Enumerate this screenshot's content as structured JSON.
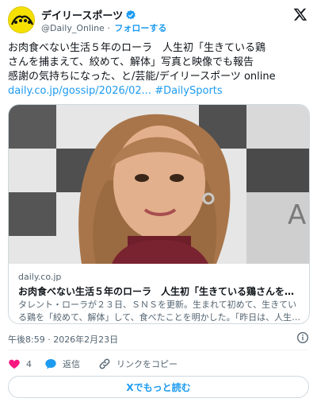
{
  "account": {
    "name": "デイリースポーツ",
    "handle": "@Daily_Online",
    "separator": " · ",
    "follow_label": "フォローする"
  },
  "tweet": {
    "text_lines": [
      "お肉食べない生活５年のローラ　人生初「生きている鶏",
      "さんを捕まえて、絞めて、解体」写真と映像でも報告",
      "感謝の気持ちになった、と/芸能/デイリースポーツ online"
    ],
    "link": "daily.co.jp/gossip/2026/02...",
    "hashtag": "#DailySports"
  },
  "card": {
    "domain": "daily.co.jp",
    "title": "お肉食べない生活５年のローラ　人生初「生きている鶏さんを捕まえて…",
    "description": "タレント・ローラが２３日、ＳＮＳを更新。生まれて初めて、生きている鶏を「絞めて、解体」して、食べたことを明かした。「昨日は、人生…"
  },
  "timestamp": "午後8:59 · 2026年2月23日",
  "actions": {
    "like_count": "4",
    "reply_label": "返信",
    "copy_link_label": "リンクをコピー"
  },
  "read_more_label": "Xでもっと読む",
  "colors": {
    "accent": "#1d9bf0",
    "like": "#f91880",
    "text_primary": "#0f1419",
    "text_secondary": "#536471",
    "avatar_bg": "#f5e000"
  },
  "icons": [
    "verified-badge-icon",
    "x-logo-icon",
    "info-icon",
    "heart-icon",
    "reply-bubble-icon",
    "link-icon"
  ]
}
